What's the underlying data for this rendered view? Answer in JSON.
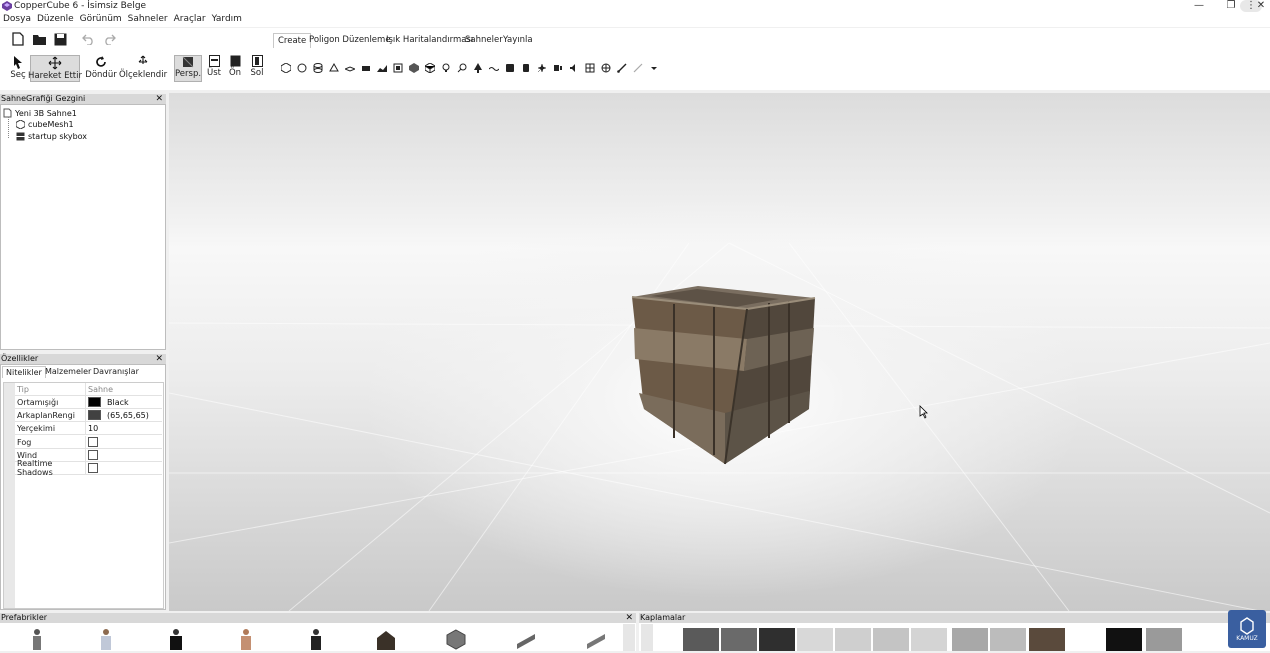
{
  "window": {
    "title": "CopperCube 6 - İsimsiz Belge",
    "controls": [
      "minimize-icon",
      "restore-icon",
      "close-icon"
    ]
  },
  "menu": [
    "Dosya",
    "Düzenle",
    "Görünüm",
    "Sahneler",
    "Araçlar",
    "Yardım"
  ],
  "tools": {
    "select": "Seç",
    "move": "Hareket Ettir",
    "rotate": "Döndür",
    "scale": "Ölçeklendir",
    "persp": "Persp.",
    "top": "Üst",
    "front": "Ön",
    "left": "Sol"
  },
  "ribbon_tabs": [
    "Create",
    "Poligon Düzenleme",
    "Işık Haritalandırması",
    "Sahneler",
    "Yayınla"
  ],
  "scenegraph": {
    "title": "SahneGrafiği Gezgini",
    "items": [
      "Yeni 3B Sahne1",
      "cubeMesh1",
      "startup skybox"
    ]
  },
  "properties": {
    "title": "Özellikler",
    "tabs": [
      "Nitelikler",
      "Malzemeler",
      "Davranışlar"
    ],
    "rows": [
      {
        "name": "Tip",
        "value": "Sahne"
      },
      {
        "name": "Ortamışığı",
        "value": "Black",
        "swatch": "#000000"
      },
      {
        "name": "ArkaplanRengi",
        "value": "(65,65,65)",
        "swatch": "#414141"
      },
      {
        "name": "Yerçekimi",
        "value": "10"
      },
      {
        "name": "Fog",
        "checkbox": false
      },
      {
        "name": "Wind",
        "checkbox": false
      },
      {
        "name": "Realtime Shadows",
        "checkbox": false
      }
    ]
  },
  "bottom": {
    "prefabs_title": "Prefabrikler",
    "textures_title": "Kaplamalar",
    "badge": "KAMUZ"
  },
  "colors": {
    "accent": "#3a5fa0",
    "panel_header": "#d8d8d8"
  }
}
